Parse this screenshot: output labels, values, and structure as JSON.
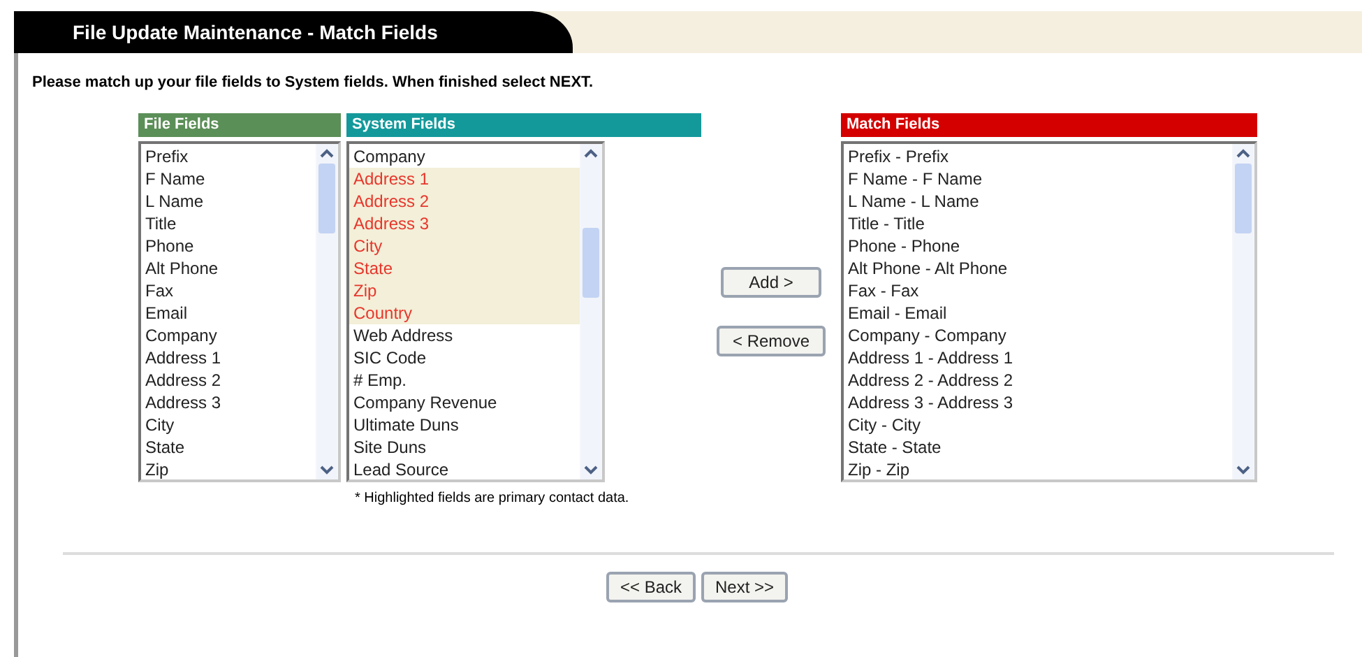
{
  "window": {
    "title": "File Update Maintenance - Match Fields"
  },
  "instructions": "Please match up your file fields to System fields.  When finished select NEXT.",
  "file_fields": {
    "heading": "File Fields",
    "items": [
      "Prefix",
      "F Name",
      "L Name",
      "Title",
      "Phone",
      "Alt Phone",
      "Fax",
      "Email",
      "Company",
      "Address 1",
      "Address 2",
      "Address 3",
      "City",
      "State",
      "Zip"
    ]
  },
  "system_fields": {
    "heading": "System Fields",
    "items": [
      {
        "label": "Company",
        "highlighted": false
      },
      {
        "label": "Address 1",
        "highlighted": true
      },
      {
        "label": "Address 2",
        "highlighted": true
      },
      {
        "label": "Address 3",
        "highlighted": true
      },
      {
        "label": "City",
        "highlighted": true
      },
      {
        "label": "State",
        "highlighted": true
      },
      {
        "label": "Zip",
        "highlighted": true
      },
      {
        "label": "Country",
        "highlighted": true
      },
      {
        "label": "Web Address",
        "highlighted": false
      },
      {
        "label": "SIC Code",
        "highlighted": false
      },
      {
        "label": "# Emp.",
        "highlighted": false
      },
      {
        "label": "Company Revenue",
        "highlighted": false
      },
      {
        "label": "Ultimate Duns",
        "highlighted": false
      },
      {
        "label": "Site Duns",
        "highlighted": false
      },
      {
        "label": "Lead Source",
        "highlighted": false
      }
    ],
    "footnote": "* Highlighted fields are primary contact data."
  },
  "actions": [
    "Add >",
    "< Remove"
  ],
  "match_fields": {
    "heading": "Match Fields",
    "items": [
      "Prefix - Prefix",
      "F Name - F Name",
      "L Name - L Name",
      "Title - Title",
      "Phone - Phone",
      "Alt Phone - Alt Phone",
      "Fax - Fax",
      "Email - Email",
      "Company - Company",
      "Address 1 - Address 1",
      "Address 2 - Address 2",
      "Address 3 - Address 3",
      "City - City",
      "State - State",
      "Zip - Zip"
    ]
  },
  "nav_buttons": [
    "<< Back",
    "Next >>"
  ]
}
